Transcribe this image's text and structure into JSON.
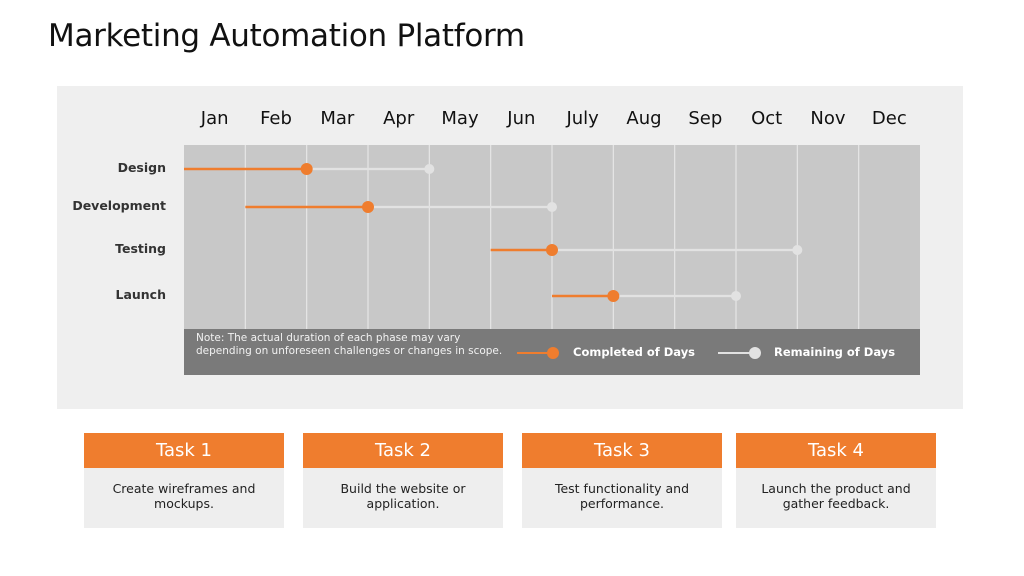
{
  "title": "Marketing Automation Platform",
  "colors": {
    "accent": "#ef7d2e",
    "grid_background": "#c8c8c8",
    "grid_line": "#e6e6e6",
    "remaining": "#e2e2e2",
    "panel": "#efefef",
    "note_bar": "#7a7a7a"
  },
  "chart_data": {
    "type": "gantt",
    "title": "Marketing Automation Platform",
    "x_unit": "months",
    "x_range": [
      0,
      12
    ],
    "categories": [
      "Jan",
      "Feb",
      "Mar",
      "Apr",
      "May",
      "Jun",
      "July",
      "Aug",
      "Sep",
      "Oct",
      "Nov",
      "Dec"
    ],
    "grid": true,
    "series_names": [
      "Completed of Days",
      "Remaining of Days"
    ],
    "phases": [
      {
        "name": "Design",
        "start": 0,
        "completed_end": 2,
        "remaining_end": 4
      },
      {
        "name": "Development",
        "start": 1,
        "completed_end": 3,
        "remaining_end": 6
      },
      {
        "name": "Testing",
        "start": 5,
        "completed_end": 6,
        "remaining_end": 10
      },
      {
        "name": "Launch",
        "start": 6,
        "completed_end": 7,
        "remaining_end": 9
      }
    ],
    "legend": [
      {
        "label": "Completed of Days",
        "color": "#ef7d2e"
      },
      {
        "label": "Remaining of Days",
        "color": "#e2e2e2"
      }
    ],
    "legend_position": "bottom-right",
    "note": "Note: The actual duration of each phase may vary depending on unforeseen challenges or changes in scope."
  },
  "tasks": [
    {
      "label": "Task 1",
      "description": "Create wireframes and mockups."
    },
    {
      "label": "Task 2",
      "description": "Build the website or application."
    },
    {
      "label": "Task 3",
      "description": "Test functionality and performance."
    },
    {
      "label": "Task 4",
      "description": "Launch the product and gather feedback."
    }
  ]
}
